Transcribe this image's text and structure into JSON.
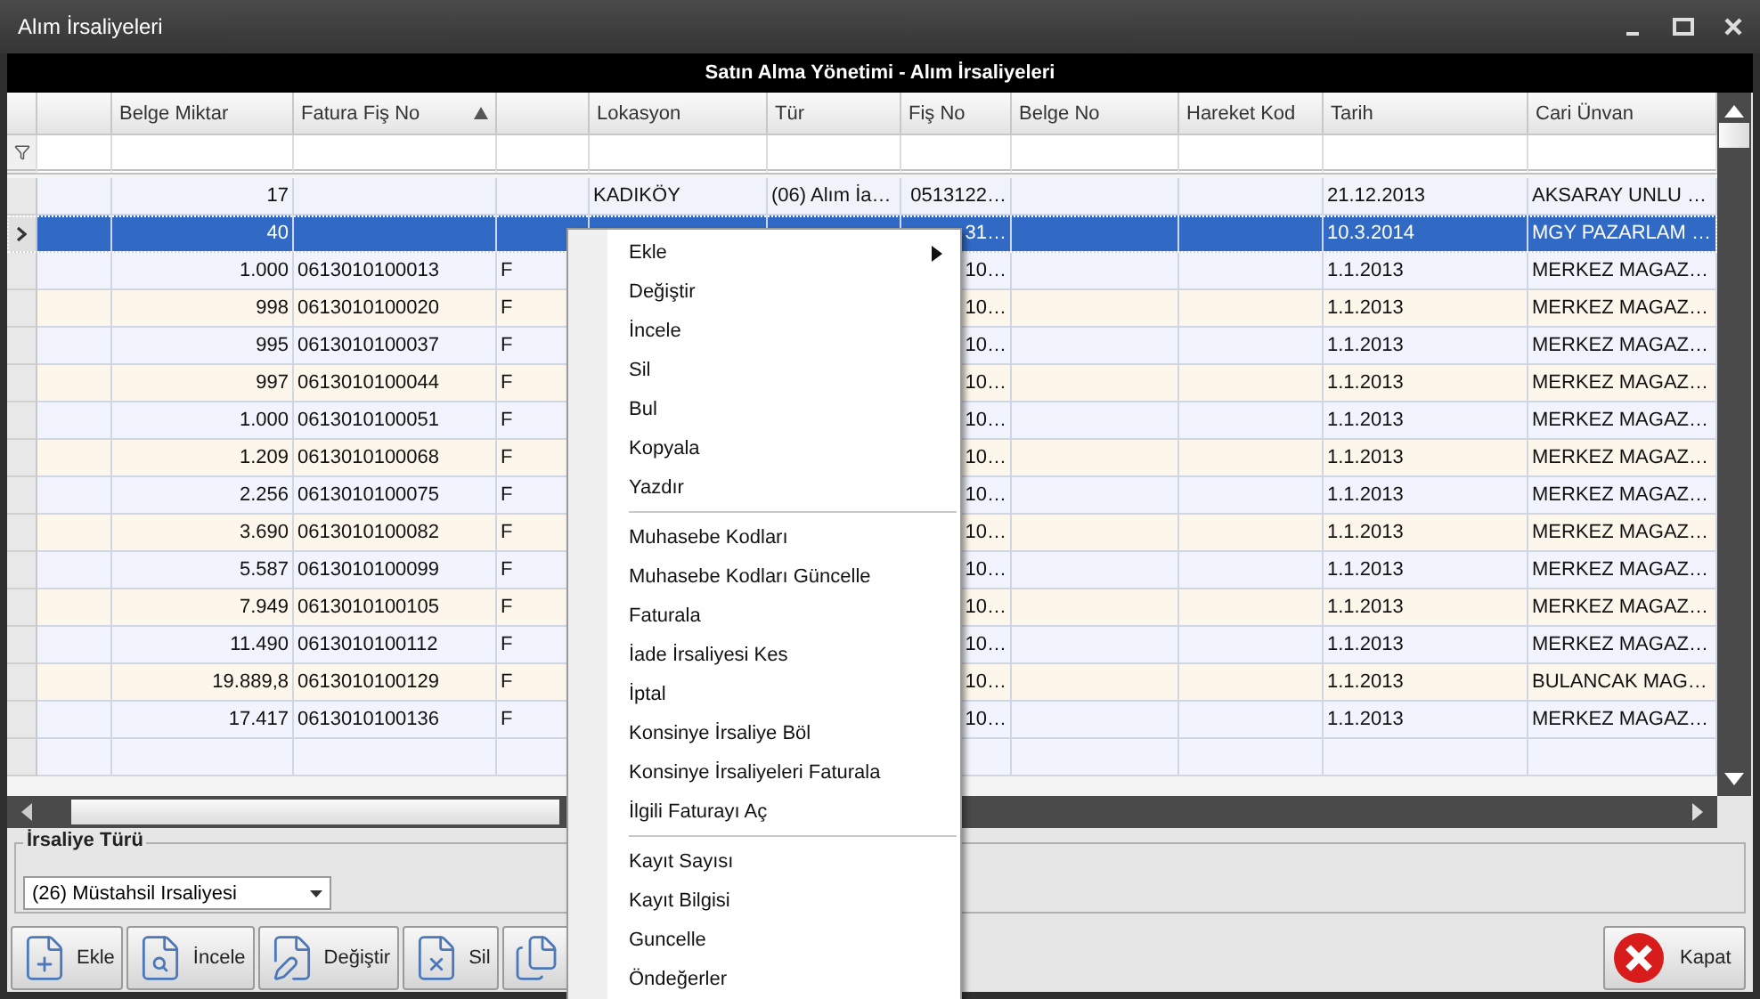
{
  "window": {
    "title": "Alım İrsaliyeleri"
  },
  "grid": {
    "caption": "Satın Alma Yönetimi - Alım İrsaliyeleri",
    "columns": [
      {},
      {
        "label": "Belge Miktar"
      },
      {
        "label": "Fatura Fiş No",
        "sorted": true
      },
      {},
      {
        "label": "Lokasyon"
      },
      {
        "label": "Tür"
      },
      {
        "label": "Fiş No"
      },
      {
        "label": "Belge No"
      },
      {
        "label": "Hareket Kod"
      },
      {
        "label": "Tarih"
      },
      {
        "label": "Cari Ünvan"
      }
    ],
    "rows": [
      {
        "selected": false,
        "belge_miktar": "17",
        "lokasyon": "KADIKÖY",
        "tur": "(06) Alım İa…",
        "fis_no": "0513122…",
        "tarih": "21.12.2013",
        "cari_unvan": "AKSARAY UNLU …"
      },
      {
        "selected": true,
        "belge_miktar": "40",
        "fis_no": "31…",
        "tarih": "10.3.2014",
        "cari_unvan": "MGY PAZARLAM …"
      },
      {
        "selected": false,
        "belge_miktar": "1.000",
        "fatura_fis_no": "0613010100013",
        "column_4": "F",
        "fis_no": "10…",
        "tarih": "1.1.2013",
        "cari_unvan": "MERKEZ MAGAZ…"
      },
      {
        "selected": false,
        "belge_miktar": "998",
        "fatura_fis_no": "0613010100020",
        "column_4": "F",
        "fis_no": "10…",
        "tarih": "1.1.2013",
        "cari_unvan": "MERKEZ MAGAZ…"
      },
      {
        "selected": false,
        "belge_miktar": "995",
        "fatura_fis_no": "0613010100037",
        "column_4": "F",
        "fis_no": "10…",
        "tarih": "1.1.2013",
        "cari_unvan": "MERKEZ MAGAZ…"
      },
      {
        "selected": false,
        "belge_miktar": "997",
        "fatura_fis_no": "0613010100044",
        "column_4": "F",
        "fis_no": "10…",
        "tarih": "1.1.2013",
        "cari_unvan": "MERKEZ MAGAZ…"
      },
      {
        "selected": false,
        "belge_miktar": "1.000",
        "fatura_fis_no": "0613010100051",
        "column_4": "F",
        "fis_no": "10…",
        "tarih": "1.1.2013",
        "cari_unvan": "MERKEZ MAGAZ…"
      },
      {
        "selected": false,
        "belge_miktar": "1.209",
        "fatura_fis_no": "0613010100068",
        "column_4": "F",
        "fis_no": "10…",
        "tarih": "1.1.2013",
        "cari_unvan": "MERKEZ MAGAZ…"
      },
      {
        "selected": false,
        "belge_miktar": "2.256",
        "fatura_fis_no": "0613010100075",
        "column_4": "F",
        "fis_no": "10…",
        "tarih": "1.1.2013",
        "cari_unvan": "MERKEZ MAGAZ…"
      },
      {
        "selected": false,
        "belge_miktar": "3.690",
        "fatura_fis_no": "0613010100082",
        "column_4": "F",
        "fis_no": "10…",
        "tarih": "1.1.2013",
        "cari_unvan": "MERKEZ MAGAZ…"
      },
      {
        "selected": false,
        "belge_miktar": "5.587",
        "fatura_fis_no": "0613010100099",
        "column_4": "F",
        "fis_no": "10…",
        "tarih": "1.1.2013",
        "cari_unvan": "MERKEZ MAGAZ…"
      },
      {
        "selected": false,
        "belge_miktar": "7.949",
        "fatura_fis_no": "0613010100105",
        "column_4": "F",
        "fis_no": "10…",
        "tarih": "1.1.2013",
        "cari_unvan": "MERKEZ MAGAZ…"
      },
      {
        "selected": false,
        "belge_miktar": "11.490",
        "fatura_fis_no": "0613010100112",
        "column_4": "F",
        "fis_no": "10…",
        "tarih": "1.1.2013",
        "cari_unvan": "MERKEZ MAGAZ…"
      },
      {
        "selected": false,
        "belge_miktar": "19.889,8",
        "fatura_fis_no": "0613010100129",
        "column_4": "F",
        "fis_no": "10…",
        "tarih": "1.1.2013",
        "cari_unvan": "BULANCAK MAG…"
      },
      {
        "selected": false,
        "belge_miktar": "17.417",
        "fatura_fis_no": "0613010100136",
        "column_4": "F",
        "fis_no": "10…",
        "tarih": "1.1.2013",
        "cari_unvan": "MERKEZ MAGAZ…"
      }
    ]
  },
  "irsaliye_turu": {
    "label": "İrsaliye Türü",
    "value": "(26) Müstahsil Irsaliyesi"
  },
  "toolbar": [
    {
      "kind": "add",
      "label": "Ekle"
    },
    {
      "kind": "view",
      "label": "İncele"
    },
    {
      "kind": "edit",
      "label": "Değiştir"
    },
    {
      "kind": "delete",
      "label": "Sil"
    },
    {
      "kind": "copy"
    }
  ],
  "close_button": {
    "label": "Kapat"
  },
  "context_menu": [
    {
      "kind": "item",
      "label": "Ekle",
      "submenu": true
    },
    {
      "kind": "item",
      "label": "Değiştir"
    },
    {
      "kind": "item",
      "label": "İncele"
    },
    {
      "kind": "item",
      "label": "Sil"
    },
    {
      "kind": "item",
      "label": "Bul"
    },
    {
      "kind": "item",
      "label": "Kopyala"
    },
    {
      "kind": "item",
      "label": "Yazdır"
    },
    {
      "kind": "separator"
    },
    {
      "kind": "item",
      "label": "Muhasebe Kodları"
    },
    {
      "kind": "item",
      "label": "Muhasebe Kodları Güncelle"
    },
    {
      "kind": "item",
      "label": "Faturala"
    },
    {
      "kind": "item",
      "label": "İade İrsaliyesi Kes"
    },
    {
      "kind": "item",
      "label": "İptal"
    },
    {
      "kind": "item",
      "label": "Konsinye İrsaliye Böl"
    },
    {
      "kind": "item",
      "label": "Konsinye İrsaliyeleri Faturala"
    },
    {
      "kind": "item",
      "label": "İlgili Faturayı Aç"
    },
    {
      "kind": "separator"
    },
    {
      "kind": "item",
      "label": "Kayıt Sayısı"
    },
    {
      "kind": "item",
      "label": "Kayıt Bilgisi"
    },
    {
      "kind": "item",
      "label": "Guncelle"
    },
    {
      "kind": "item",
      "label": "Öndeğerler"
    }
  ]
}
